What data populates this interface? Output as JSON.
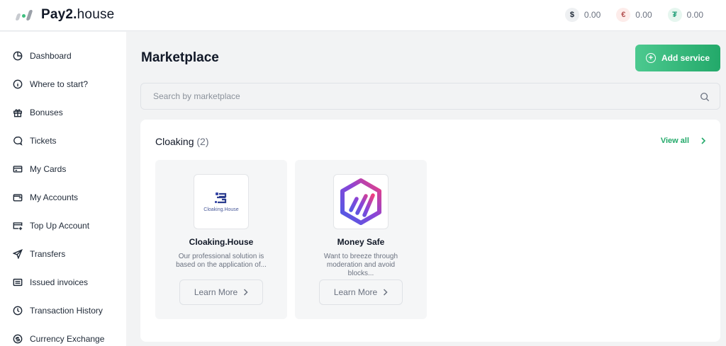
{
  "header": {
    "logo_text_bold": "Pay2.",
    "logo_text_light": "house",
    "balances": [
      {
        "symbol": "$",
        "currency": "usd",
        "value": "0.00"
      },
      {
        "symbol": "€",
        "currency": "eur",
        "value": "0.00"
      },
      {
        "symbol": "₮",
        "currency": "usdt",
        "value": "0.00"
      }
    ]
  },
  "sidebar": {
    "items": [
      {
        "label": "Dashboard",
        "icon": "pie-chart-icon"
      },
      {
        "label": "Where to start?",
        "icon": "info-icon"
      },
      {
        "label": "Bonuses",
        "icon": "gift-icon"
      },
      {
        "label": "Tickets",
        "icon": "chat-bubble-icon"
      },
      {
        "label": "My Cards",
        "icon": "credit-card-icon"
      },
      {
        "label": "My Accounts",
        "icon": "wallet-icon"
      },
      {
        "label": "Top Up Account",
        "icon": "card-add-icon"
      },
      {
        "label": "Transfers",
        "icon": "send-icon"
      },
      {
        "label": "Issued invoices",
        "icon": "invoice-icon"
      },
      {
        "label": "Transaction History",
        "icon": "clock-icon"
      },
      {
        "label": "Currency Exchange",
        "icon": "exchange-icon"
      }
    ]
  },
  "main": {
    "title": "Marketplace",
    "add_service_label": "Add service",
    "search_placeholder": "Search by marketplace",
    "section": {
      "title": "Cloaking",
      "count": "(2)",
      "view_all_label": "View all"
    },
    "cards": [
      {
        "name": "Cloaking.House",
        "logo_text": "Cloaking.House",
        "description": "Our professional solution is based on the application of...",
        "button_label": "Learn More"
      },
      {
        "name": "Money Safe",
        "description": "Want to breeze through moderation and avoid blocks...",
        "button_label": "Learn More"
      }
    ]
  },
  "colors": {
    "accent": "#23a96a",
    "background": "#f2f3f4"
  }
}
